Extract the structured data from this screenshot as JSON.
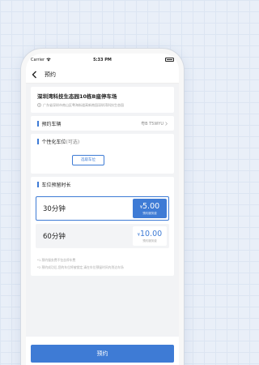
{
  "status_bar": {
    "carrier": "Carrier",
    "time": "5:33 PM",
    "wifi_icon": "wifi-icon",
    "battery_icon": "battery-icon"
  },
  "nav": {
    "title": "预约",
    "back_icon": "chevron-left-icon"
  },
  "location": {
    "name": "深圳湾科技生态园10栋B座停车场",
    "address": "广东省深圳市南山区粤海街道高新南园深圳湾科技生态园",
    "pin_icon": "location-pin-icon"
  },
  "vehicle": {
    "label": "预约车辆",
    "plate": "粤B T5WYU",
    "chevron_icon": "chevron-right-icon"
  },
  "custom_spot": {
    "label": "个性化车位",
    "optional": "(可选)",
    "button": "选取车位"
  },
  "retention": {
    "label": "车位预留时长",
    "options": [
      {
        "duration": "30分钟",
        "currency": "¥",
        "price": "5.00",
        "note": "预约服务费",
        "selected": true
      },
      {
        "duration": "60分钟",
        "currency": "¥",
        "price": "10.00",
        "note": "预约服务费",
        "selected": false
      }
    ]
  },
  "notes": [
    "*1.预约服务费不包含停车费",
    "*2.预约成功后,您的车位将被锁定,请在车位预留时间内到达车场"
  ],
  "submit": {
    "label": "预约"
  },
  "colors": {
    "accent": "#3e7bd5",
    "background": "#e9eff8"
  }
}
